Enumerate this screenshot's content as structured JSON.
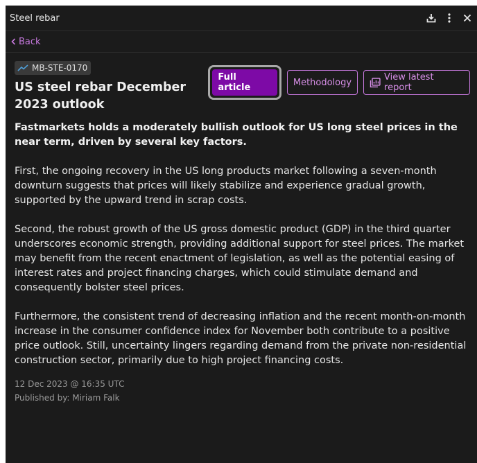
{
  "window": {
    "title": "Steel rebar"
  },
  "nav": {
    "back_label": "Back"
  },
  "article": {
    "code": "MB-STE-0170",
    "title": "US steel rebar December 2023 outlook",
    "lead": "Fastmarkets holds a moderately bullish outlook for US long steel prices in the near term, driven by several key factors.",
    "paragraphs": [
      "First, the ongoing recovery in the US long products market following a seven-month downturn suggests that prices will likely stabilize and experience gradual growth, supported by the upward trend in scrap costs.",
      "Second, the robust growth of the US gross domestic product (GDP) in the third quarter underscores economic strength, providing additional support for steel prices. The market may benefit from the recent enactment of legislation, as well as the potential easing of interest rates and project financing charges, which could stimulate demand and consequently bolster steel prices.",
      "Furthermore, the consistent trend of decreasing inflation and the recent month-on-month increase in the consumer confidence index for November both contribute to a positive price outlook. Still, uncertainty lingers regarding demand from the private non-residential construction sector, primarily due to high project financing costs."
    ],
    "date": "12 Dec 2023 @ 16:35 UTC",
    "published_by": "Published by: Miriam Falk"
  },
  "buttons": {
    "full_article": "Full article",
    "methodology": "Methodology",
    "view_latest_report": "View latest report"
  },
  "colors": {
    "accent": "#c678dd",
    "primary_button": "#7d0aa6",
    "background": "#1b1b1b"
  }
}
